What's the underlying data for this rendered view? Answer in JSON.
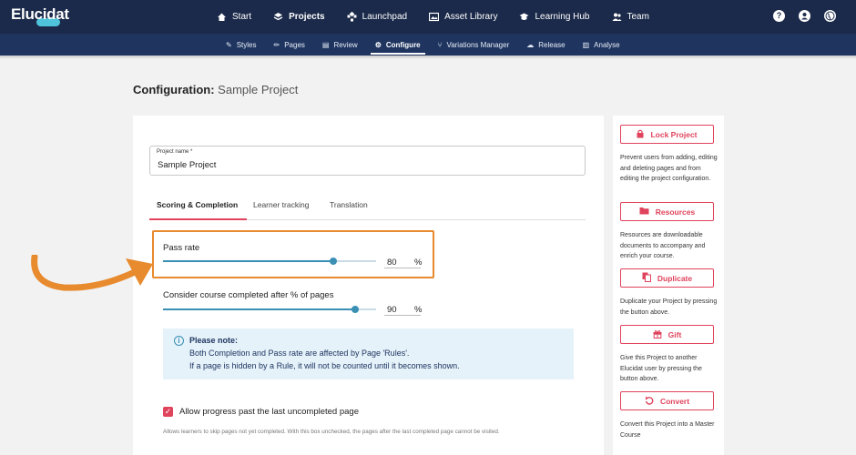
{
  "app": {
    "logo_text": "Elucidat"
  },
  "main_nav": [
    {
      "label": "Start",
      "icon": "home-icon"
    },
    {
      "label": "Projects",
      "icon": "layers-icon",
      "active": true
    },
    {
      "label": "Launchpad",
      "icon": "launchpad-icon"
    },
    {
      "label": "Asset Library",
      "icon": "image-icon"
    },
    {
      "label": "Learning Hub",
      "icon": "graduation-cap-icon"
    },
    {
      "label": "Team",
      "icon": "team-icon"
    }
  ],
  "header_icons": {
    "help": "?",
    "user": "user-icon",
    "globe": "globe-icon"
  },
  "sub_nav": [
    {
      "label": "Styles",
      "icon": "brush-icon"
    },
    {
      "label": "Pages",
      "icon": "pencil-icon"
    },
    {
      "label": "Review",
      "icon": "comment-icon"
    },
    {
      "label": "Configure",
      "icon": "gear-icon",
      "active": true
    },
    {
      "label": "Variations Manager",
      "icon": "branch-icon"
    },
    {
      "label": "Release",
      "icon": "cloud-upload-icon"
    },
    {
      "label": "Analyse",
      "icon": "bar-chart-icon"
    }
  ],
  "page_title": {
    "prefix": "Configuration:",
    "project": "Sample Project"
  },
  "project_name": {
    "label": "Project name *",
    "value": "Sample Project"
  },
  "tabs": [
    {
      "label": "Scoring & Completion",
      "active": true
    },
    {
      "label": "Learner tracking"
    },
    {
      "label": "Translation"
    }
  ],
  "pass_rate": {
    "label": "Pass rate",
    "value": "80",
    "unit": "%",
    "level": 0.8
  },
  "completion": {
    "label": "Consider course completed after % of pages",
    "value": "90",
    "unit": "%",
    "level": 0.9
  },
  "note": {
    "title": "Please note:",
    "line1": "Both Completion and Pass rate are affected by Page 'Rules'.",
    "line2": "If a page is hidden by a Rule, it will not be counted until it becomes shown."
  },
  "allow_progress": {
    "label": "Allow progress past the last uncompleted page",
    "checked": true,
    "help": "Allows learners to skip pages not yet completed. With this box unchecked, the pages after the last completed page cannot be visited."
  },
  "side_actions": [
    {
      "label": "Lock Project",
      "icon": "lock-icon",
      "desc": "Prevent users from adding, editing and deleting pages and from editing the project configuration."
    },
    {
      "label": "Resources",
      "icon": "folder-icon",
      "desc": "Resources are downloadable documents to accompany and enrich your course."
    },
    {
      "label": "Duplicate",
      "icon": "copy-icon",
      "desc": "Duplicate your Project by pressing the button above."
    },
    {
      "label": "Gift",
      "icon": "gift-icon",
      "desc": "Give this Project to another Elucidat user by pressing the button above."
    },
    {
      "label": "Convert",
      "icon": "undo-icon",
      "desc": "Convert this Project into a Master Course"
    }
  ],
  "colors": {
    "nav": "#1b2a4a",
    "subnav": "#1f3560",
    "accent": "#e0435c",
    "slider": "#3a8fb4",
    "highlight": "#e88a2e"
  }
}
